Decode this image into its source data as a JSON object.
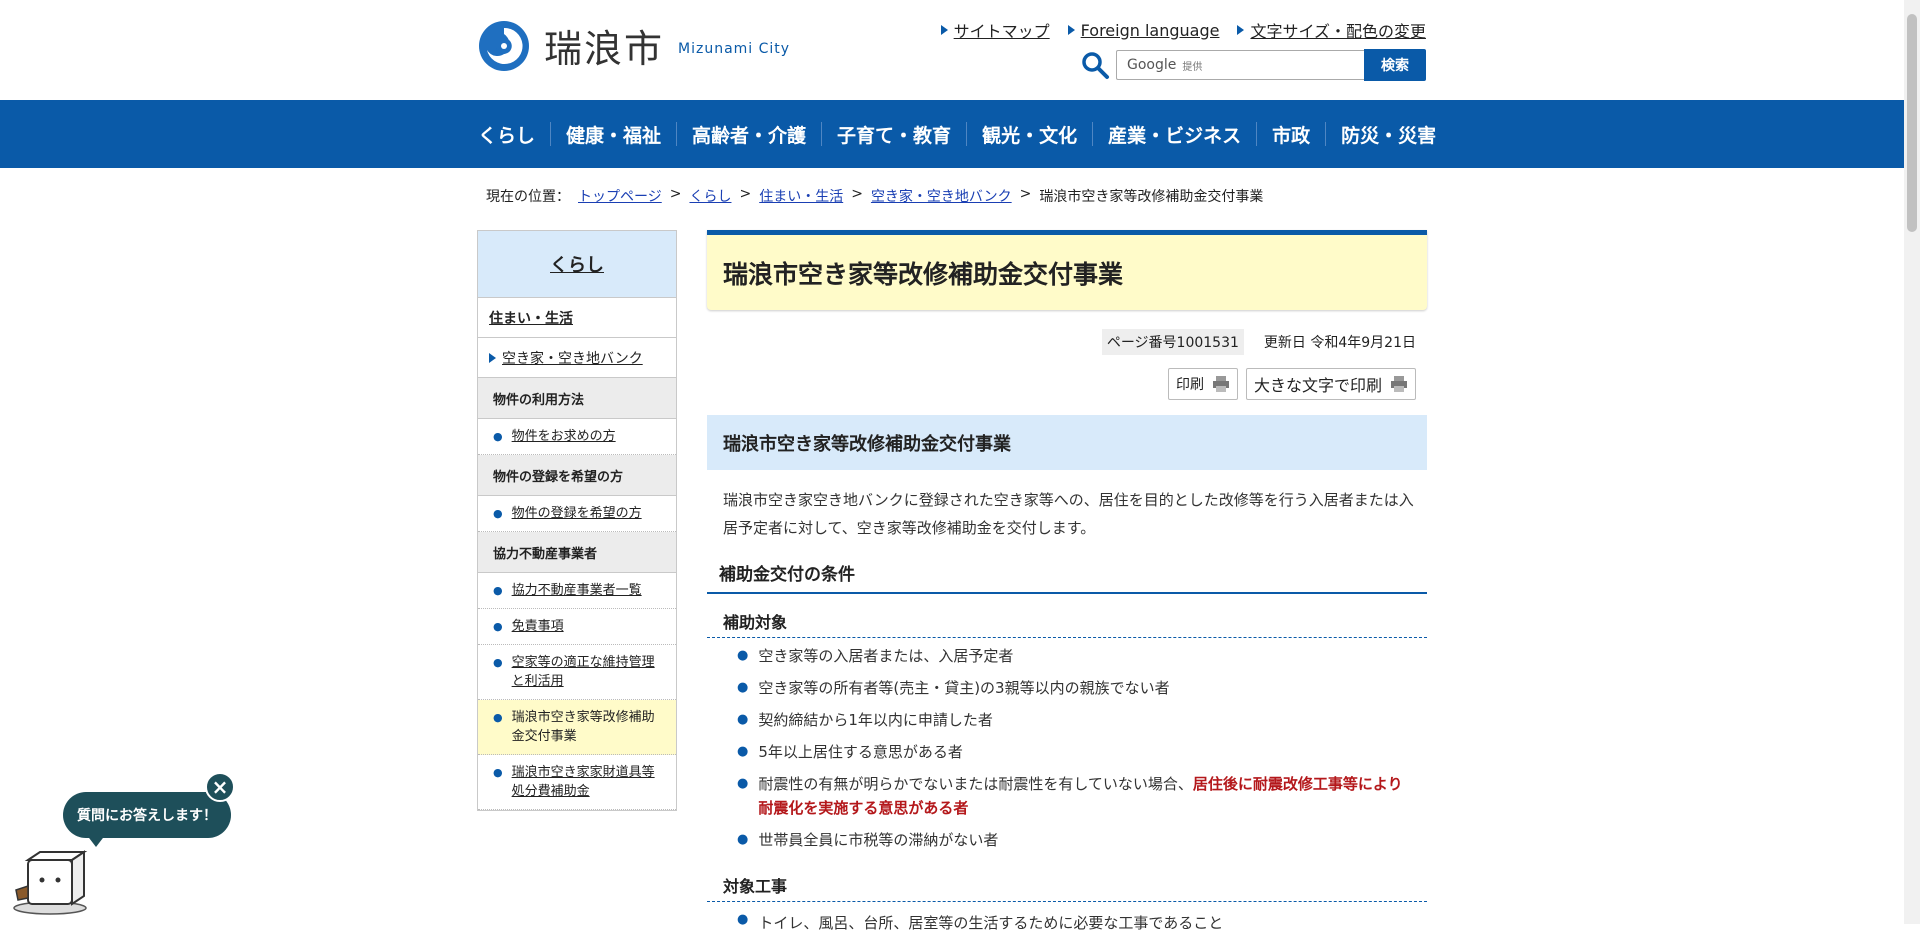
{
  "header": {
    "logo_name": "瑞浪市",
    "logo_en": "Mizunami City",
    "util_links": [
      "サイトマップ",
      "Foreign language",
      "文字サイズ・配色の変更"
    ],
    "search": {
      "provider": "Google",
      "provider_sub": "提供",
      "button": "検索"
    }
  },
  "gnav": [
    "くらし",
    "健康・福祉",
    "高齢者・介護",
    "子育て・教育",
    "観光・文化",
    "産業・ビジネス",
    "市政",
    "防災・災害"
  ],
  "breadcrumb": {
    "prefix": "現在の位置：",
    "items": [
      "トップページ",
      "くらし",
      "住まい・生活",
      "空き家・空き地バンク"
    ],
    "sep": ">",
    "current": "瑞浪市空き家等改修補助金交付事業"
  },
  "sidenav": {
    "head": "くらし",
    "section": "住まい・生活",
    "sub": "空き家・空き地バンク",
    "groups": [
      {
        "title": "物件の利用方法",
        "links": [
          "物件をお求めの方"
        ]
      },
      {
        "title": "物件の登録を希望の方",
        "links": [
          "物件の登録を希望の方"
        ]
      },
      {
        "title": "協力不動産事業者",
        "links": [
          "協力不動産事業者一覧",
          "免責事項",
          "空家等の適正な維持管理と利活用",
          "瑞浪市空き家等改修補助金交付事業",
          "瑞浪市空き家家財道具等処分費補助金"
        ]
      }
    ]
  },
  "main": {
    "title": "瑞浪市空き家等改修補助金交付事業",
    "page_no": "ページ番号1001531",
    "updated": "更新日 令和4年9月21日",
    "print": "印刷",
    "print_big": "大きな文字で印刷",
    "h2": "瑞浪市空き家等改修補助金交付事業",
    "intro": "瑞浪市空き家空き地バンクに登録された空き家等への、居住を目的とした改修等を行う入居者または入居予定者に対して、空き家等改修補助金を交付します。",
    "h3": "補助金交付の条件",
    "h4_target": "補助対象",
    "conditions": [
      "空き家等の入居者または、入居予定者",
      "空き家等の所有者等(売主・貸主)の3親等以内の親族でない者",
      "契約締結から1年以内に申請した者",
      "5年以上居住する意思がある者"
    ],
    "condition_quake_plain": "耐震性の有無が明らかでないまたは耐震性を有していない場合、",
    "condition_quake_red": "居住後に耐震改修工事等により耐震化を実施する意思がある者",
    "condition_tax": "世帯員全員に市税等の滞納がない者",
    "h4_work": "対象工事",
    "work_first": "トイレ、風呂、台所、居室等の生活するために必要な工事であること"
  },
  "chatbot": {
    "bubble": "質問にお答えします！",
    "close": "×"
  },
  "colors": {
    "brand_blue": "#0a5aa8",
    "title_bg": "#fffbc9",
    "heading_bg": "#d8eafa",
    "alert_red": "#b4181b"
  }
}
